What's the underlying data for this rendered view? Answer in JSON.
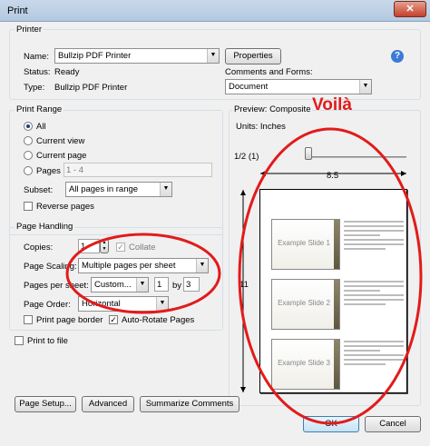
{
  "window": {
    "title": "Print",
    "close_label": "✕"
  },
  "printer": {
    "group_label": "Printer",
    "name_label": "Name:",
    "name_value": "Bullzip PDF Printer",
    "properties_label": "Properties",
    "status_label": "Status:",
    "status_value": "Ready",
    "type_label": "Type:",
    "type_value": "Bullzip PDF Printer",
    "comments_label": "Comments and Forms:",
    "comments_value": "Document",
    "help_icon": "?"
  },
  "print_range": {
    "group_label": "Print Range",
    "all_label": "All",
    "current_view_label": "Current view",
    "current_page_label": "Current page",
    "pages_label": "Pages",
    "pages_value": "1 - 4",
    "subset_label": "Subset:",
    "subset_value": "All pages in range",
    "reverse_label": "Reverse pages"
  },
  "page_handling": {
    "group_label": "Page Handling",
    "copies_label": "Copies:",
    "copies_value": "1",
    "collate_label": "Collate",
    "scaling_label": "Page Scaling:",
    "scaling_value": "Multiple pages per sheet",
    "pps_label": "Pages per sheet:",
    "pps_value": "Custom...",
    "cols_value": "1",
    "by_label": "by",
    "rows_value": "3",
    "order_label": "Page Order:",
    "order_value": "Horizontal",
    "border_label": "Print page border",
    "autorotate_label": "Auto-Rotate Pages"
  },
  "print_to_file_label": "Print to file",
  "preview": {
    "label": "Preview: Composite",
    "units": "Units: Inches",
    "zoom": "1/2 (1)",
    "width": "8.5",
    "height": "11",
    "slides": [
      "Example Slide 1",
      "Example Slide 2",
      "Example Slide 3"
    ]
  },
  "annotation": {
    "text": "Voilà",
    "color": "#e21b1b"
  },
  "buttons": {
    "page_setup": "Page Setup...",
    "advanced": "Advanced",
    "summarize": "Summarize Comments",
    "ok": "OK",
    "cancel": "Cancel"
  }
}
